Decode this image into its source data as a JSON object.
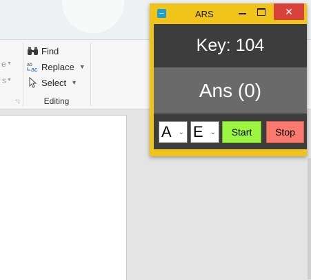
{
  "ribbon": {
    "fragments": [
      "e",
      "s"
    ],
    "find_label": "Find",
    "replace_label": "Replace",
    "select_label": "Select",
    "group_label": "Editing"
  },
  "ars": {
    "title": "ARS",
    "key_text": "Key: 104",
    "ans_text": "Ans (0)",
    "select_a": "A",
    "select_e": "E",
    "start_label": "Start",
    "stop_label": "Stop",
    "colors": {
      "frame": "#f0c419",
      "panel_dark": "#3d3d3d",
      "panel_mid": "#6a6a6a",
      "start": "#9cf540",
      "stop": "#fa7a70",
      "close": "#d9413b"
    }
  },
  "icons": {
    "find": "binoculars-icon",
    "replace": "replace-icon",
    "select": "cursor-icon",
    "close": "close-icon",
    "minimize": "minimize-icon",
    "maximize": "maximize-icon",
    "app": "ars-app-icon"
  }
}
